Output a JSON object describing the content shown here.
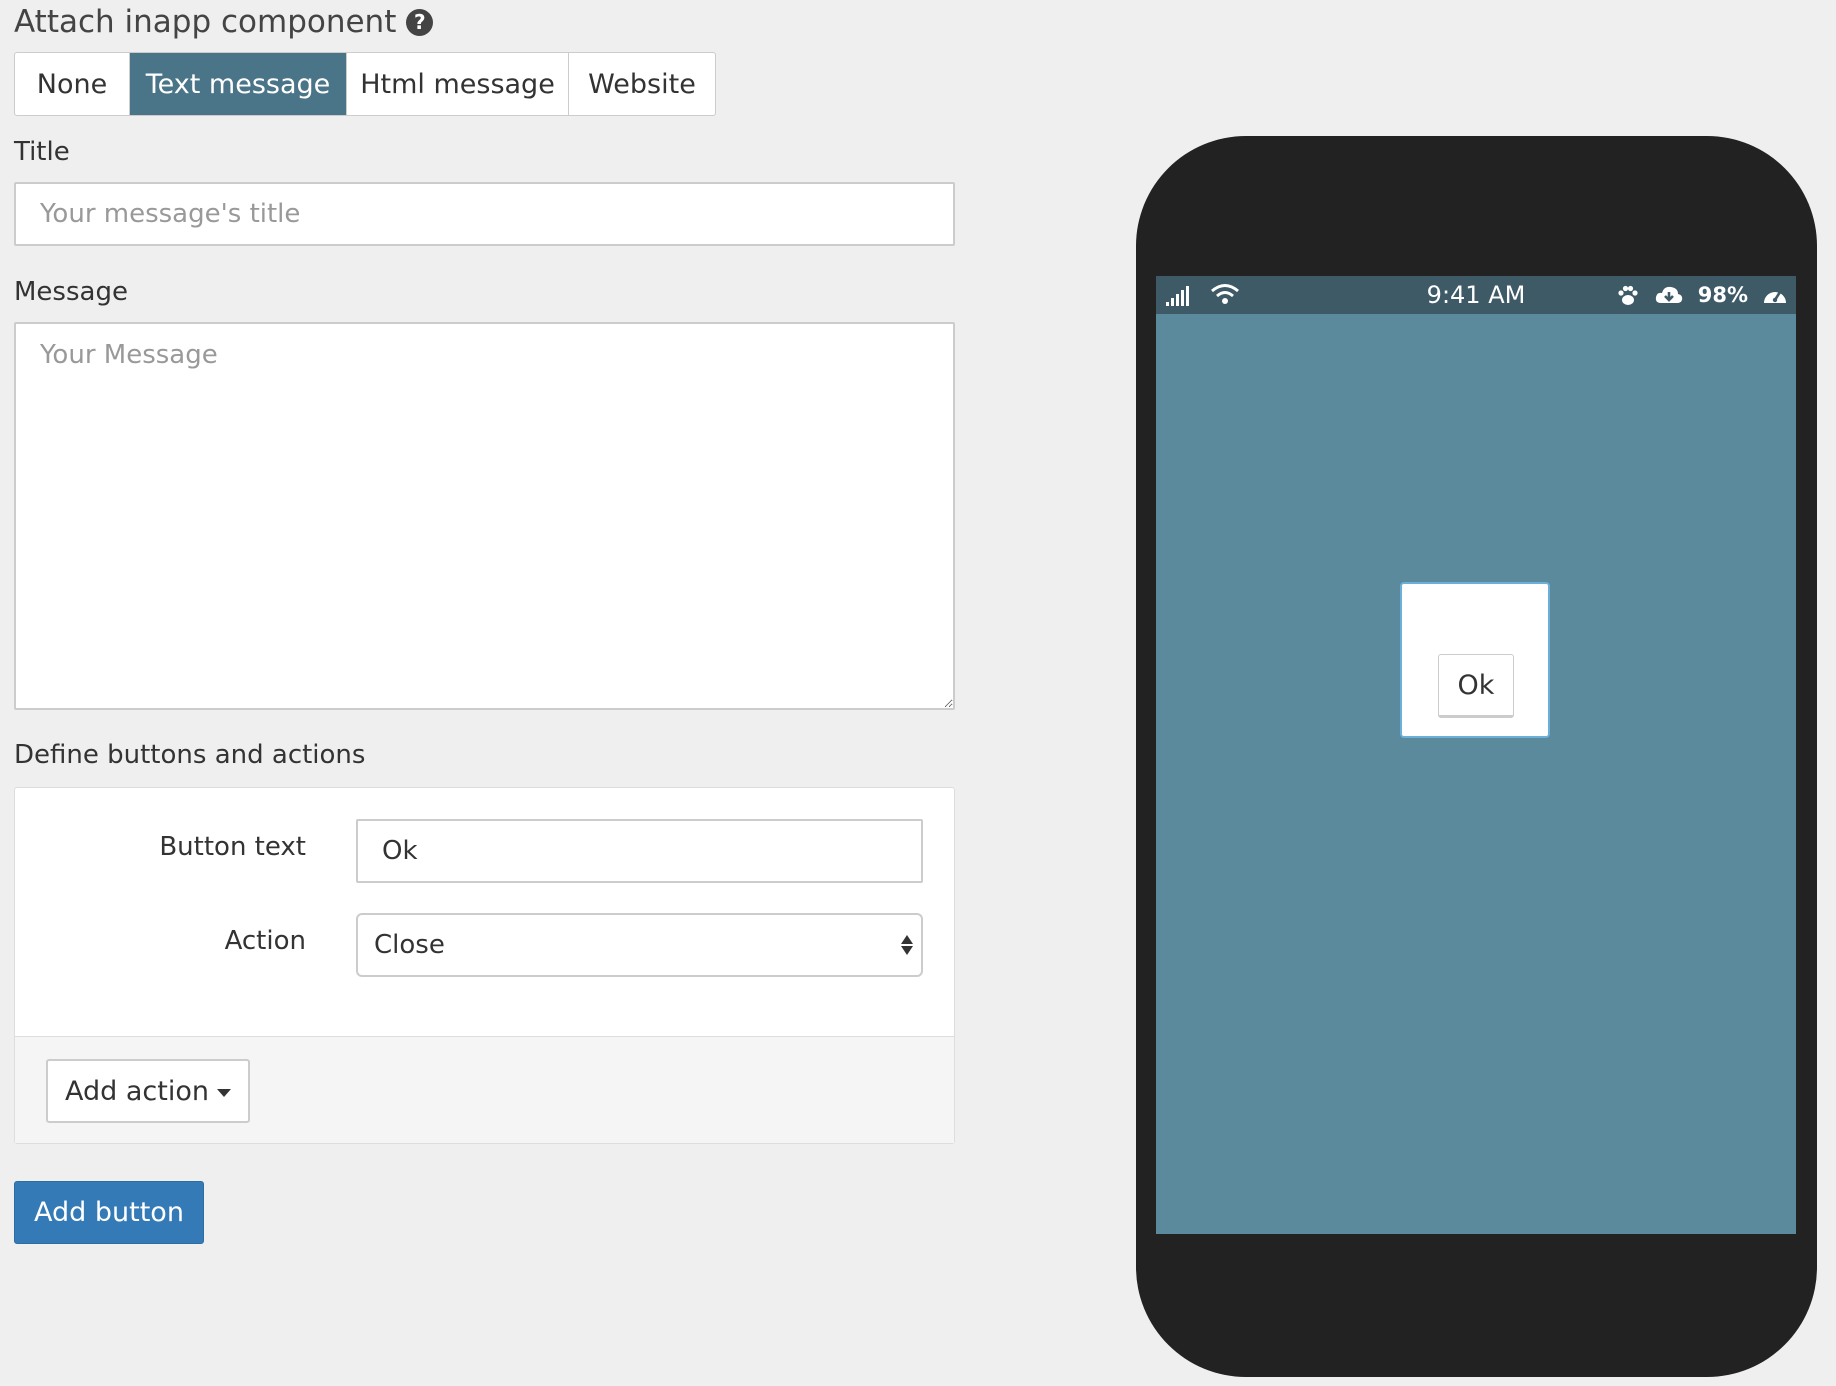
{
  "header": {
    "title": "Attach inapp component",
    "help_icon": "question-circle-icon"
  },
  "component_types": {
    "options": [
      "None",
      "Text message",
      "Html message",
      "Website"
    ],
    "selected": "Text message"
  },
  "form": {
    "title_label": "Title",
    "title_placeholder": "Your message's title",
    "title_value": "",
    "message_label": "Message",
    "message_placeholder": "Your Message",
    "message_value": ""
  },
  "buttons_section": {
    "heading": "Define buttons and actions",
    "button_text_label": "Button text",
    "button_text_value": "Ok",
    "action_label": "Action",
    "action_selected": "Close",
    "add_action_label": "Add action",
    "add_button_label": "Add button"
  },
  "phone_preview": {
    "status_time": "9:41 AM",
    "battery": "98%",
    "status_icons": [
      "signal-icon",
      "wifi-icon",
      "paw-icon",
      "cloud-download-icon",
      "dashboard-icon"
    ],
    "dialog_button_label": "Ok",
    "colors": {
      "screen_bg": "#5a8a9c",
      "statusbar_bg": "#3e5a66",
      "phone_body": "#222222"
    }
  },
  "colors": {
    "accent_selected": "#4a7588",
    "primary": "#337ab7",
    "background": "#efefef"
  }
}
